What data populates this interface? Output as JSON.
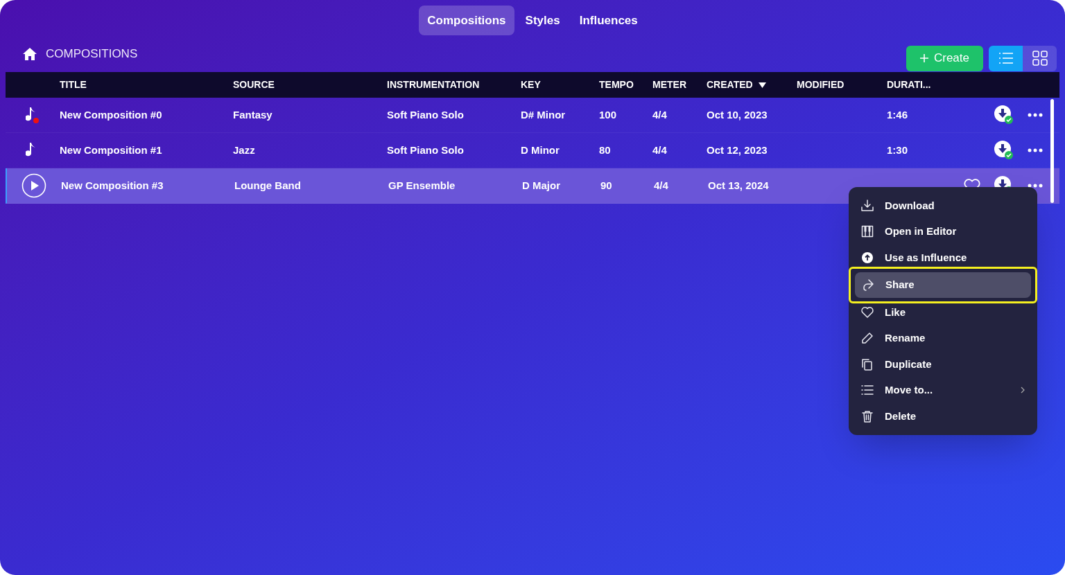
{
  "tabs": [
    {
      "label": "Compositions",
      "selected": true
    },
    {
      "label": "Styles",
      "selected": false
    },
    {
      "label": "Influences",
      "selected": false
    }
  ],
  "breadcrumb": {
    "label": "COMPOSITIONS"
  },
  "create_button": {
    "label": "Create"
  },
  "view_toggle": [
    {
      "kind": "list",
      "selected": true
    },
    {
      "kind": "grid",
      "selected": false
    }
  ],
  "table": {
    "columns": [
      {
        "label": "TITLE",
        "sorted": false
      },
      {
        "label": "SOURCE",
        "sorted": false
      },
      {
        "label": "INSTRUMENTATION",
        "sorted": false
      },
      {
        "label": "KEY",
        "sorted": false
      },
      {
        "label": "TEMPO",
        "sorted": false
      },
      {
        "label": "METER",
        "sorted": false
      },
      {
        "label": "CREATED",
        "sorted": true
      },
      {
        "label": "MODIFIED",
        "sorted": false
      },
      {
        "label": "DURATI...",
        "sorted": false
      }
    ],
    "rows": [
      {
        "title": "New Composition #0",
        "source": "Fantasy",
        "instrumentation": "Soft Piano Solo",
        "key": "D# Minor",
        "tempo": "100",
        "meter": "4/4",
        "created": "Oct 10, 2023",
        "duration": "1:46",
        "selected": false,
        "new": true,
        "downloaded": true
      },
      {
        "title": "New Composition #1",
        "source": "Jazz",
        "instrumentation": "Soft Piano Solo",
        "key": "D Minor",
        "tempo": "80",
        "meter": "4/4",
        "created": "Oct 12, 2023",
        "duration": "1:30",
        "selected": false,
        "new": false,
        "downloaded": true
      },
      {
        "title": "New Composition #3",
        "source": "Lounge Band",
        "instrumentation": "GP Ensemble",
        "key": "D Major",
        "tempo": "90",
        "meter": "4/4",
        "created": "Oct 13, 2024",
        "selected": true,
        "new": false,
        "downloaded": true
      }
    ]
  },
  "context_menu": {
    "items": [
      {
        "kind": "download",
        "label": "Download",
        "selected": false,
        "annotated": false,
        "submenu": false
      },
      {
        "kind": "editor",
        "label": "Open in Editor",
        "selected": false,
        "annotated": false,
        "submenu": false
      },
      {
        "kind": "influence",
        "label": "Use as Influence",
        "selected": false,
        "annotated": false,
        "submenu": false
      },
      {
        "kind": "share",
        "label": "Share",
        "selected": true,
        "annotated": true,
        "submenu": false
      },
      {
        "kind": "like",
        "label": "Like",
        "selected": false,
        "annotated": false,
        "submenu": false
      },
      {
        "kind": "rename",
        "label": "Rename",
        "selected": false,
        "annotated": false,
        "submenu": false
      },
      {
        "kind": "duplicate",
        "label": "Duplicate",
        "selected": false,
        "annotated": false,
        "submenu": false
      },
      {
        "kind": "move",
        "label": "Move to...",
        "selected": false,
        "annotated": false,
        "submenu": true
      },
      {
        "kind": "delete",
        "label": "Delete",
        "selected": false,
        "annotated": false,
        "submenu": false
      }
    ]
  }
}
